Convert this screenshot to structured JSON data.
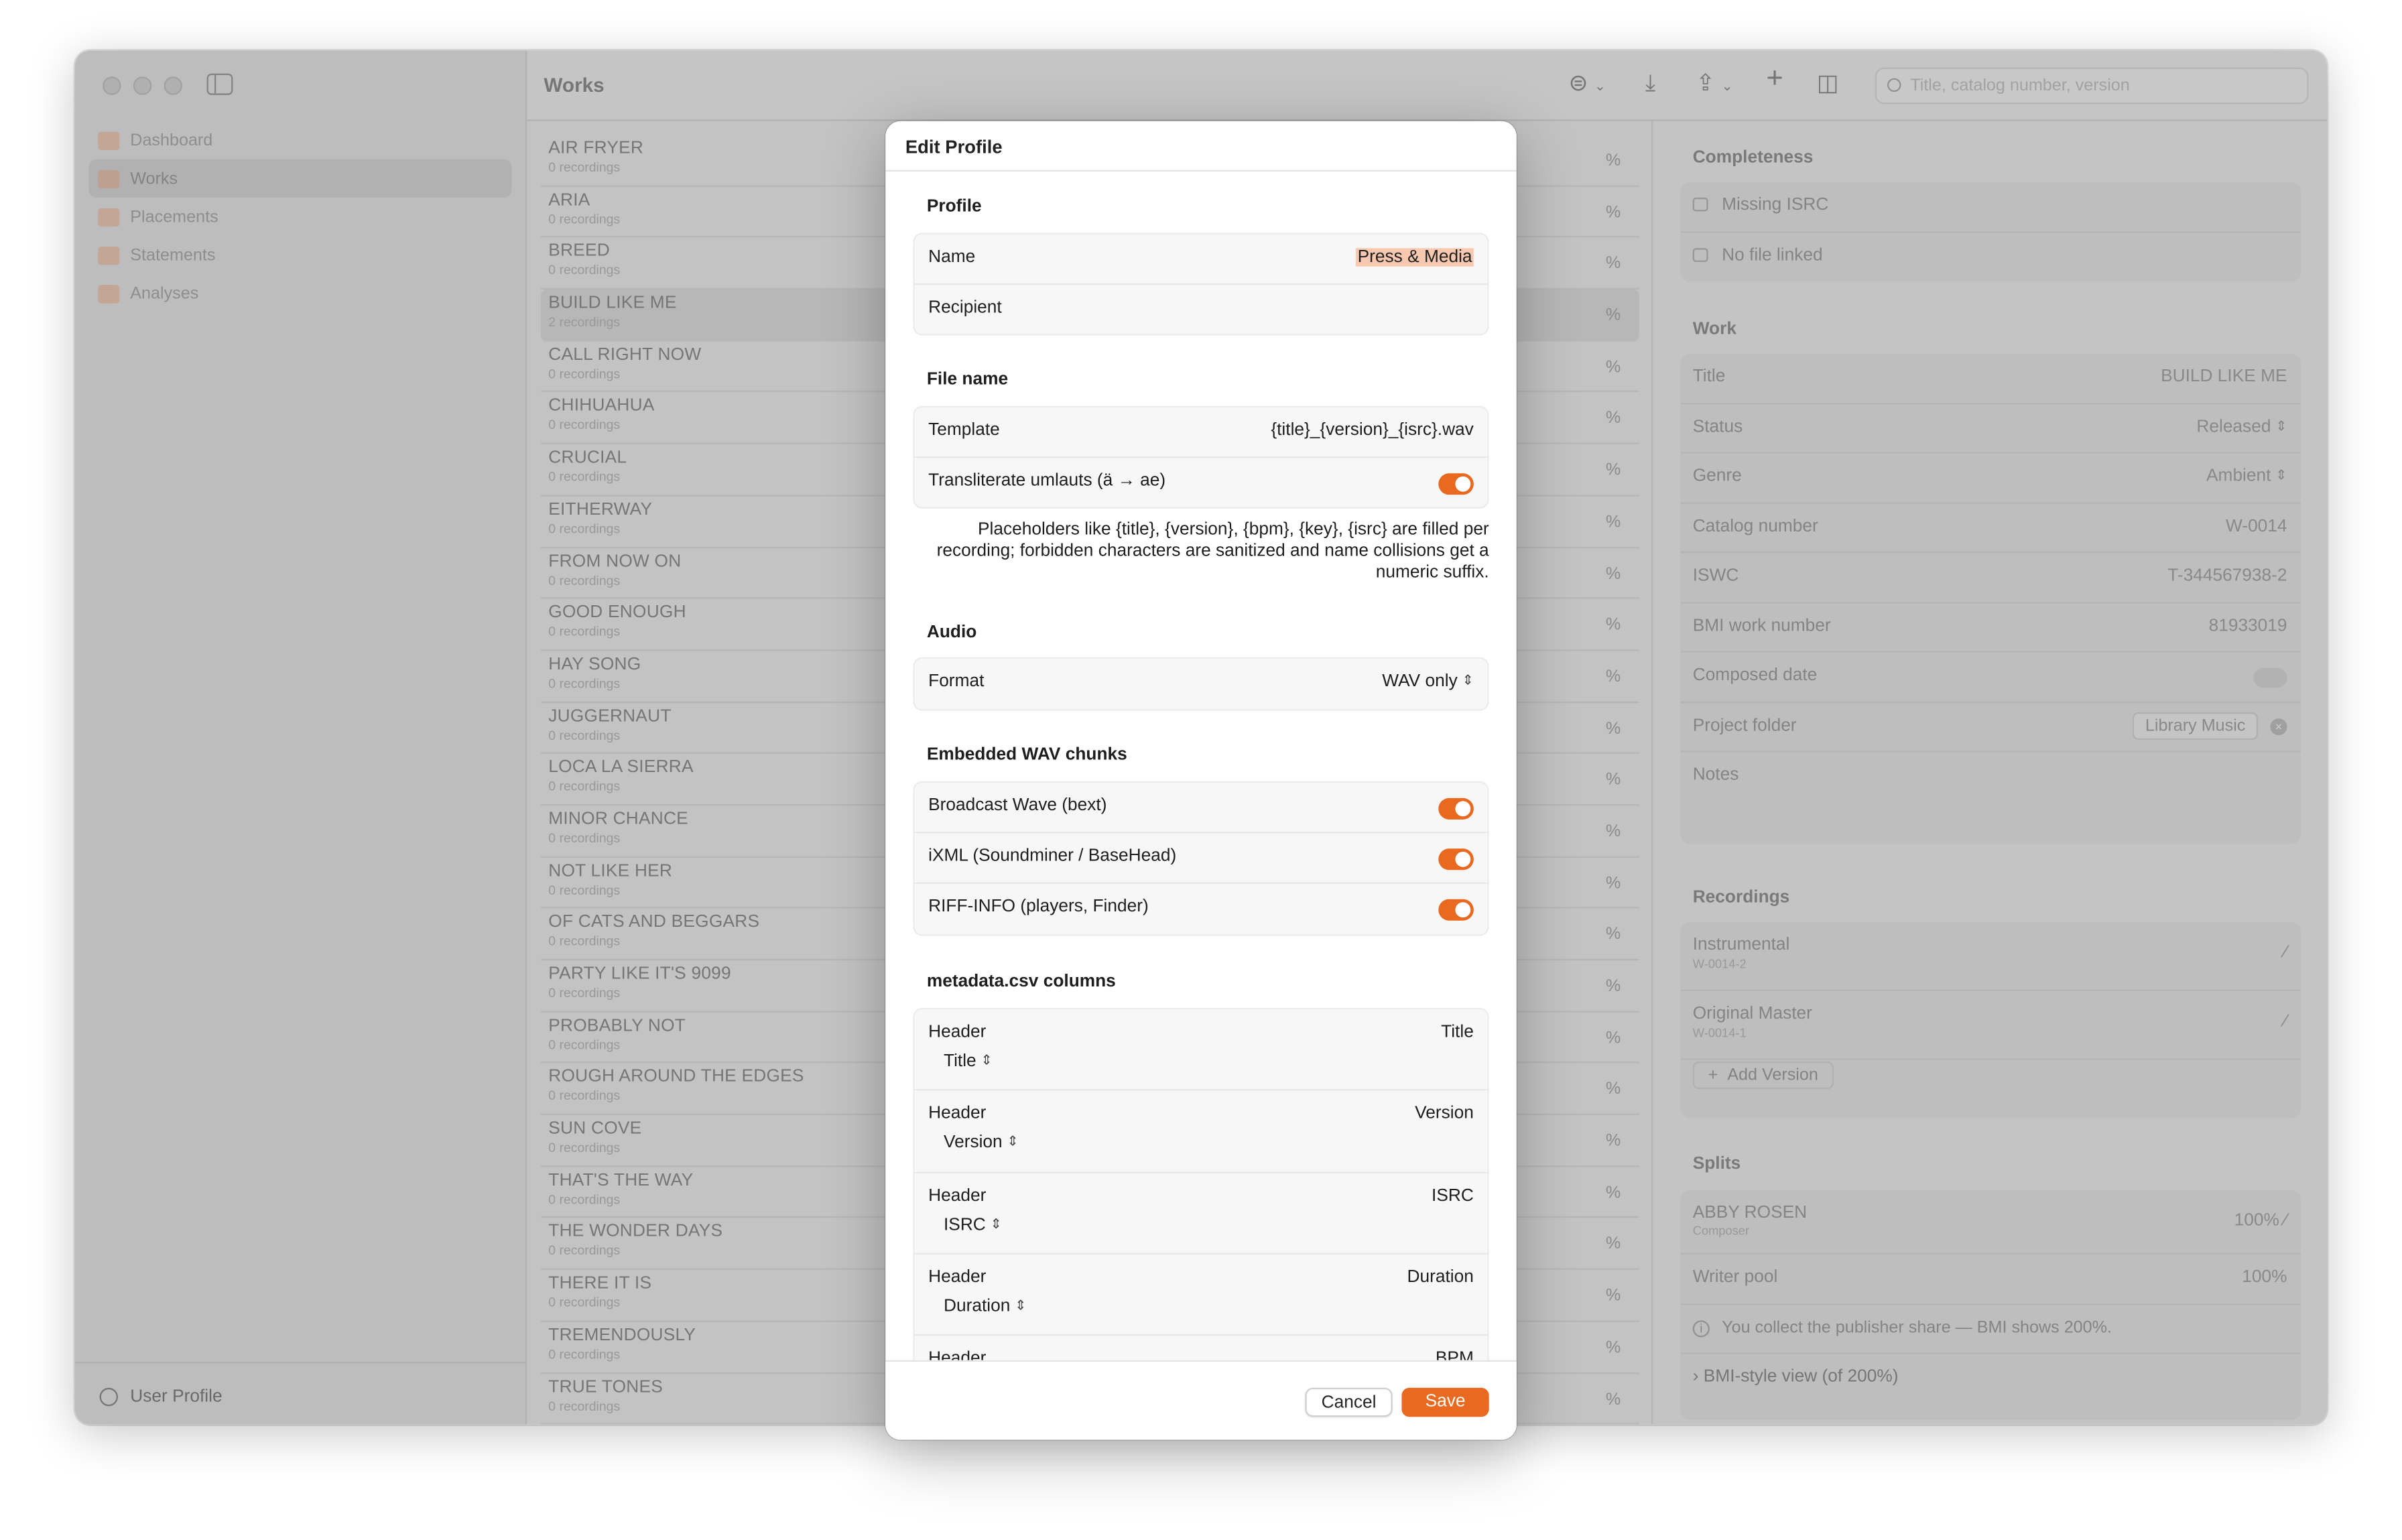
{
  "window_title": "Works",
  "sidebar": {
    "items": [
      {
        "label": "Dashboard",
        "icon": "dashboard-icon",
        "color": "#f0a27a"
      },
      {
        "label": "Works",
        "icon": "works-icon",
        "color": "#f0a27a"
      },
      {
        "label": "Placements",
        "icon": "placements-icon",
        "color": "#f0a27a"
      },
      {
        "label": "Statements",
        "icon": "statements-icon",
        "color": "#f0a27a"
      },
      {
        "label": "Analyses",
        "icon": "analyses-icon",
        "color": "#f0a27a"
      }
    ],
    "selected_index": 1,
    "user_profile_label": "User Profile"
  },
  "toolbar": {
    "search_placeholder": "Title, catalog number, version",
    "icons": [
      "filter-icon",
      "import-icon",
      "share-icon",
      "add-icon",
      "inspector-toggle-icon",
      "search-icon"
    ]
  },
  "works": [
    {
      "title": "AIR FRYER",
      "sub": "0 recordings",
      "pct": "%"
    },
    {
      "title": "ARIA",
      "sub": "0 recordings",
      "pct": "%"
    },
    {
      "title": "BREED",
      "sub": "0 recordings",
      "pct": "%"
    },
    {
      "title": "BUILD LIKE ME",
      "sub": "2 recordings",
      "pct": "%"
    },
    {
      "title": "CALL RIGHT NOW",
      "sub": "0 recordings",
      "pct": "%"
    },
    {
      "title": "CHIHUAHUA",
      "sub": "0 recordings",
      "pct": "%"
    },
    {
      "title": "CRUCIAL",
      "sub": "0 recordings",
      "pct": "%"
    },
    {
      "title": "EITHERWAY",
      "sub": "0 recordings",
      "pct": "%"
    },
    {
      "title": "FROM NOW ON",
      "sub": "0 recordings",
      "pct": "%"
    },
    {
      "title": "GOOD ENOUGH",
      "sub": "0 recordings",
      "pct": "%"
    },
    {
      "title": "HAY SONG",
      "sub": "0 recordings",
      "pct": "%"
    },
    {
      "title": "JUGGERNAUT",
      "sub": "0 recordings",
      "pct": "%"
    },
    {
      "title": "LOCA LA SIERRA",
      "sub": "0 recordings",
      "pct": "%"
    },
    {
      "title": "MINOR CHANCE",
      "sub": "0 recordings",
      "pct": "%"
    },
    {
      "title": "NOT LIKE HER",
      "sub": "0 recordings",
      "pct": "%"
    },
    {
      "title": "OF CATS AND BEGGARS",
      "sub": "0 recordings",
      "pct": "%"
    },
    {
      "title": "PARTY LIKE IT'S 9099",
      "sub": "0 recordings",
      "pct": "%"
    },
    {
      "title": "PROBABLY NOT",
      "sub": "0 recordings",
      "pct": "%"
    },
    {
      "title": "ROUGH AROUND THE EDGES",
      "sub": "0 recordings",
      "pct": "%"
    },
    {
      "title": "SUN COVE",
      "sub": "0 recordings",
      "pct": "%"
    },
    {
      "title": "THAT'S THE WAY",
      "sub": "0 recordings",
      "pct": "%"
    },
    {
      "title": "THE WONDER DAYS",
      "sub": "0 recordings",
      "pct": "%"
    },
    {
      "title": "THERE IT IS",
      "sub": "0 recordings",
      "pct": "%"
    },
    {
      "title": "TREMENDOUSLY",
      "sub": "0 recordings",
      "pct": "%"
    },
    {
      "title": "TRUE TONES",
      "sub": "0 recordings",
      "pct": "%"
    }
  ],
  "selected_work_index": 3,
  "detail": {
    "completeness": {
      "heading": "Completeness",
      "items": [
        {
          "label": "Missing ISRC",
          "icon": "barcode-icon"
        },
        {
          "label": "No file linked",
          "icon": "waveform-slash-icon"
        }
      ]
    },
    "work": {
      "heading": "Work",
      "fields": [
        {
          "label": "Title",
          "value": "BUILD LIKE ME"
        },
        {
          "label": "Status",
          "value": "Released"
        },
        {
          "label": "Genre",
          "value": "Ambient"
        },
        {
          "label": "Catalog number",
          "value": "W-0014"
        },
        {
          "label": "ISWC",
          "value": "T-344567938-2"
        },
        {
          "label": "BMI work number",
          "value": "81933019"
        },
        {
          "label": "Composed date",
          "value": ""
        },
        {
          "label": "Project folder",
          "value": "Library Music"
        },
        {
          "label": "Notes",
          "value": ""
        }
      ]
    },
    "recordings": {
      "heading": "Recordings",
      "items": [
        {
          "title": "Instrumental",
          "code": "W-0014-2"
        },
        {
          "title": "Original Master",
          "code": "W-0014-1"
        }
      ],
      "add_label": "Add Version"
    },
    "splits": {
      "heading": "Splits",
      "items": [
        {
          "name": "ABBY ROSEN",
          "role": "Composer",
          "pct": "100%"
        },
        {
          "name": "Writer pool",
          "role": "",
          "pct": "100%"
        }
      ],
      "note": "You collect the publisher share — BMI shows 200%.",
      "disclosure": "BMI-style view (of 200%)"
    }
  },
  "sheet": {
    "title": "Edit Profile",
    "profile": {
      "heading": "Profile",
      "name_label": "Name",
      "name_value": "Press & Media",
      "recipient_label": "Recipient",
      "recipient_value": ""
    },
    "file_name": {
      "heading": "File name",
      "template_label": "Template",
      "template_value": "{title}_{version}_{isrc}.wav",
      "translit_label": "Transliterate umlauts (ä → ae)",
      "translit_on": true,
      "note": "Placeholders like {title}, {version}, {bpm}, {key}, {isrc} are filled per recording; forbidden characters are sanitized and name collisions get a numeric suffix."
    },
    "audio": {
      "heading": "Audio",
      "format_label": "Format",
      "format_value": "WAV only"
    },
    "chunks": {
      "heading": "Embedded WAV chunks",
      "items": [
        {
          "label": "Broadcast Wave (bext)",
          "on": true
        },
        {
          "label": "iXML (Soundminer / BaseHead)",
          "on": true
        },
        {
          "label": "RIFF-INFO (players, Finder)",
          "on": true
        }
      ]
    },
    "csv": {
      "heading": "metadata.csv columns",
      "columns": [
        {
          "label": "Header",
          "header": "Title",
          "field": "Title"
        },
        {
          "label": "Header",
          "header": "Version",
          "field": "Version"
        },
        {
          "label": "Header",
          "header": "ISRC",
          "field": "ISRC"
        },
        {
          "label": "Header",
          "header": "Duration",
          "field": "Duration"
        },
        {
          "label": "Header",
          "header": "BPM",
          "field": ""
        }
      ]
    },
    "cancel_label": "Cancel",
    "save_label": "Save",
    "accent_color": "#e8691f"
  }
}
